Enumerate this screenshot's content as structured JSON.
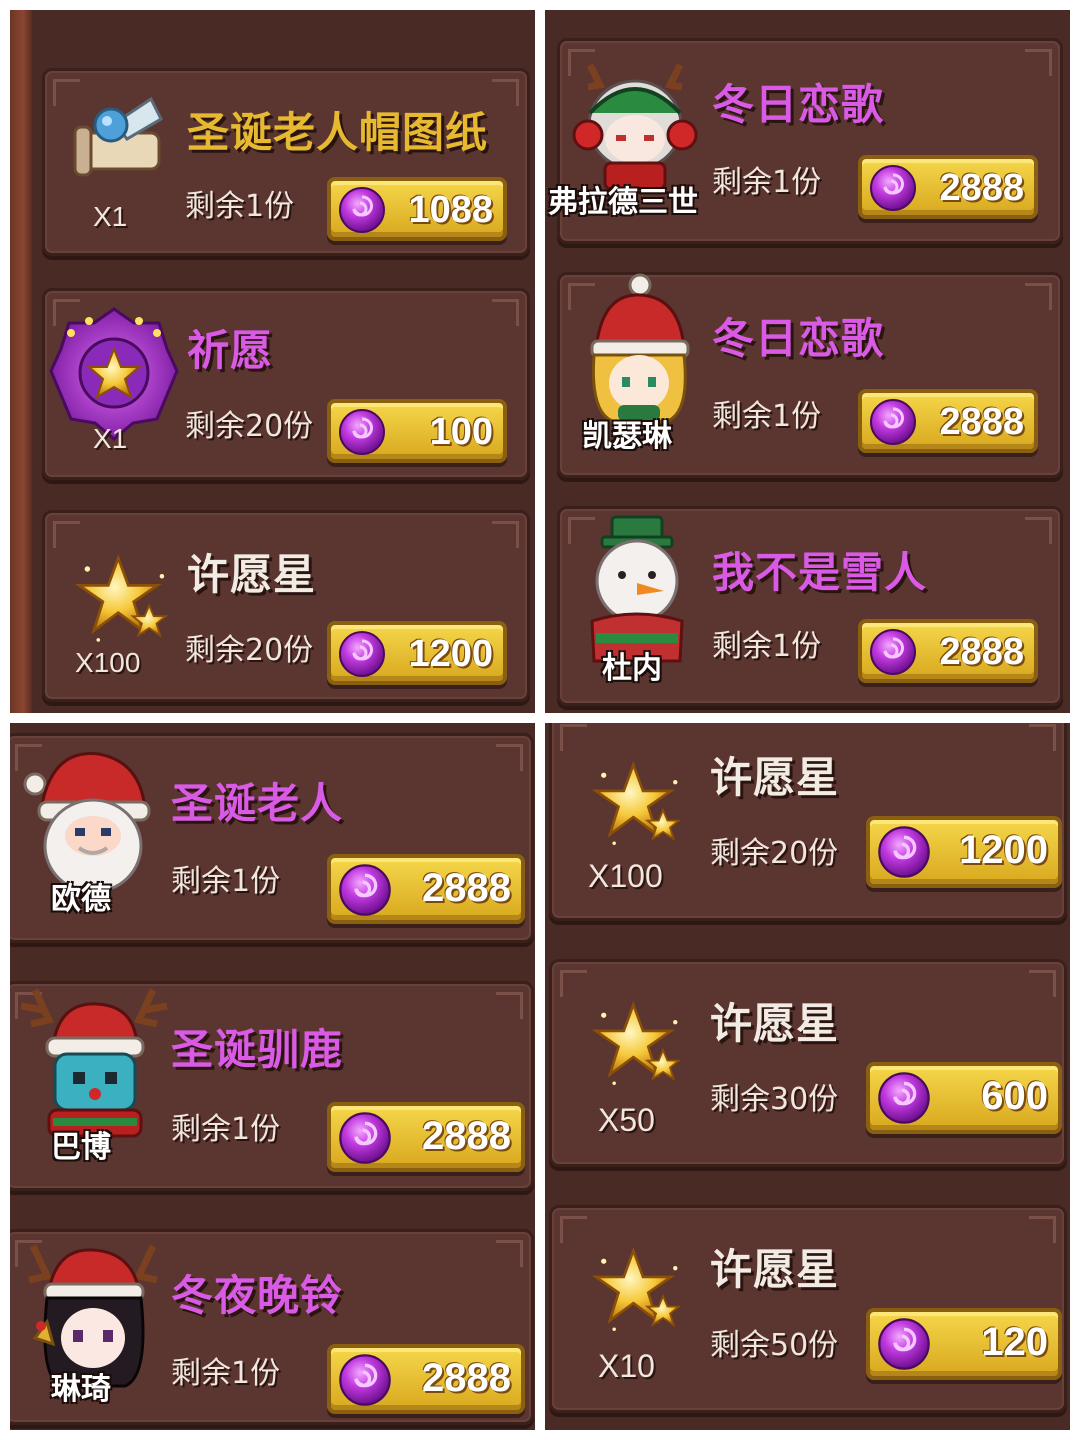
{
  "colors": {
    "panel_bg": "#4a2a24",
    "card_bg": "#5b3530",
    "title_gold": "#e6b930",
    "title_pink": "#d95be5",
    "title_white": "#f2ebe4",
    "button_gold": "#f5d64a",
    "gem_purple": "#b42ad8"
  },
  "panels": [
    {
      "items": [
        {
          "title": "圣诞老人帽图纸",
          "title_color": "gold",
          "quantity": "X1",
          "remaining": "剩余1份",
          "price": "1088",
          "icon": "scroll-blueprint-icon"
        },
        {
          "title": "祈愿",
          "title_color": "pink",
          "quantity": "X1",
          "remaining": "剩余20份",
          "price": "100",
          "icon": "wish-emblem-icon"
        },
        {
          "title": "许愿星",
          "title_color": "white",
          "quantity": "X100",
          "remaining": "剩余20份",
          "price": "1200",
          "icon": "wish-star-icon"
        }
      ]
    },
    {
      "items": [
        {
          "title": "冬日恋歌",
          "title_color": "pink",
          "character": "弗拉德三世",
          "remaining": "剩余1份",
          "price": "2888",
          "icon": "reindeer-headphone-character-icon"
        },
        {
          "title": "冬日恋歌",
          "title_color": "pink",
          "character": "凯瑟琳",
          "remaining": "剩余1份",
          "price": "2888",
          "icon": "santa-hat-blonde-character-icon"
        },
        {
          "title": "我不是雪人",
          "title_color": "pink",
          "character": "杜内",
          "remaining": "剩余1份",
          "price": "2888",
          "icon": "snowman-character-icon"
        }
      ]
    },
    {
      "items": [
        {
          "title": "圣诞老人",
          "title_color": "pink",
          "character": "欧德",
          "remaining": "剩余1份",
          "price": "2888",
          "icon": "santa-claus-character-icon"
        },
        {
          "title": "圣诞驯鹿",
          "title_color": "pink",
          "character": "巴博",
          "remaining": "剩余1份",
          "price": "2888",
          "icon": "reindeer-robot-character-icon"
        },
        {
          "title": "冬夜晚铃",
          "title_color": "pink",
          "character": "琳琦",
          "remaining": "剩余1份",
          "price": "2888",
          "icon": "bell-girl-character-icon"
        }
      ]
    },
    {
      "items": [
        {
          "title": "许愿星",
          "title_color": "white",
          "quantity": "X100",
          "remaining": "剩余20份",
          "price": "1200",
          "icon": "wish-star-icon"
        },
        {
          "title": "许愿星",
          "title_color": "white",
          "quantity": "X50",
          "remaining": "剩余30份",
          "price": "600",
          "icon": "wish-star-icon"
        },
        {
          "title": "许愿星",
          "title_color": "white",
          "quantity": "X10",
          "remaining": "剩余50份",
          "price": "120",
          "icon": "wish-star-icon"
        }
      ]
    }
  ]
}
